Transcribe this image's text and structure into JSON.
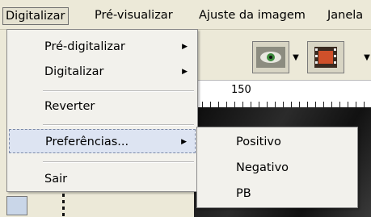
{
  "menubar": {
    "items": [
      "Digitalizar",
      "Pré-visualizar",
      "Ajuste da imagem",
      "Janela"
    ]
  },
  "menu": {
    "items": [
      {
        "label": "Pré-digitalizar",
        "submenu_arrow": "▶"
      },
      {
        "label": "Digitalizar",
        "submenu_arrow": "▶"
      },
      {
        "label": "Reverter"
      },
      {
        "label": "Preferências...",
        "submenu_arrow": "▶"
      },
      {
        "label": "Sair"
      }
    ]
  },
  "submenu": {
    "items": [
      "Positivo",
      "Negativo",
      "PB"
    ]
  },
  "ruler": {
    "label": "150"
  },
  "toolbar": {
    "dropdown_arrow": "▼"
  },
  "colors": {
    "highlight": "#dde4f2",
    "menu_bg": "#f2f1ec",
    "chrome": "#ece9d8"
  }
}
